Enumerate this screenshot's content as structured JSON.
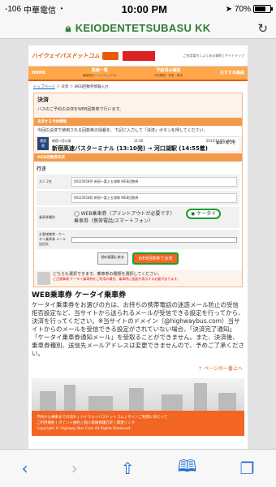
{
  "status": {
    "signal": "-106",
    "carrier": "中華電信",
    "time": "10:00 PM",
    "battery": "70%"
  },
  "urlbar": {
    "domain": "KEIODENTETSUBASU KK"
  },
  "header": {
    "logo": "ハイウェイバスドットコム",
    "links": "ご利用案内 | よくある質問 | サイトマップ"
  },
  "nav": [
    {
      "label": "HOME",
      "sub": ""
    },
    {
      "label": "路線一覧",
      "sub": "路線案内・ハイウェイバス"
    },
    {
      "label": "予約済み確認",
      "sub": "予約確認・変更・取消"
    },
    {
      "label": "おすすめ路線",
      "sub": ""
    }
  ],
  "breadcrumb": {
    "home": "トップページ",
    "rest": "＞ 決済 ＞ WEB回数券情報入力"
  },
  "page": {
    "title": "決済",
    "desc": "バスのご予約の決済をWEB回数券で行います。"
  },
  "ticket_section": {
    "heading": "決済する予約情報",
    "text": "今回の決済で使用される回数券の情報を、下記に入力して「決済」ボタンを押してください。",
    "trip_labels": [
      "運賃",
      "便"
    ],
    "trip_row": [
      "新宿→河口湖",
      "11:00",
      "2015/12/16 (Wed)"
    ],
    "route": "新宿高速バスターミナル (13:10発) → 河口湖駅 (14:55着)",
    "pax": "乗車人数 2名"
  },
  "pay_section": {
    "heading": "WEB回数券決済",
    "label": "行き",
    "rows": [
      {
        "k": "大人 2名",
        "v": "[K0236589] 新宿～富士五湖線 WEB回数券"
      },
      {
        "k": "",
        "v": "[K0236588] 新宿～富士五湖線 WEB回数券"
      }
    ],
    "choice_label": "乗車券種別",
    "option_web": "WEB乗車券（プリントアウトが必要です）",
    "option_keitai": "ケータイ",
    "option_keitai_2": "乗車券（携帯電話/スマートフォン）",
    "email_label": "お客様携帯・ケータイ乗車券 メール送信先",
    "back_btn": "前の画面に戻る",
    "pay_btn": "WEB回数券で決済"
  },
  "note": {
    "text": "どちらも選択できます。乗車券の種類を選択してください。",
    "red": "ご注意事項 ケータイ乗車券をご利用の場合、乗車時に画面を表示する必要があります。"
  },
  "keitai": {
    "heading": "WEB乗車券 ケータイ乗車券",
    "body": "ケータイ乗車券をお選びの方は、お持ちの携帯電話の迷惑メール防止の受信拒否設定など、当サイトから送られるメールが受信できる設定を行ってから、決済を行ってください。※当サイトのドメイン（@highwaybus.com）当サイトからのメールを受信できる設定がされていない場合、「決済完了通知」「ケータイ乗車券通知メール」を受取ることができません。また、決済後、乗車券種別、送信先メールアドレスは変更できませんので、予めご了承ください。"
  },
  "backtop": "↑ ページの一番上へ",
  "footer": {
    "line1": "予約から乗車までの流れ | ハイウェイバスドットコム | サイトご利用にあたって",
    "line2": "ご利用規約 | ポイント規約 | 個人情報保護方針 | 関連リンク",
    "copyright": "Copyright © Highway Bus Com All Rights Reserved."
  },
  "toolbar": {
    "back": "<",
    "forward": ">",
    "share": "share",
    "bookmarks": "bookmarks",
    "tabs": "tabs"
  }
}
